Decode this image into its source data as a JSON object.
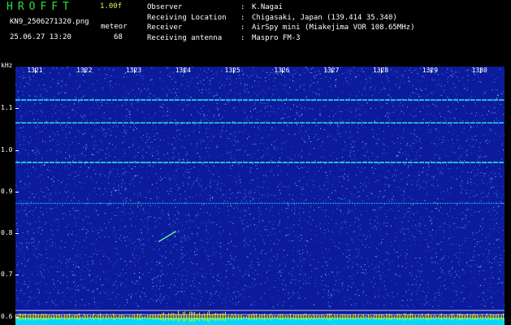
{
  "header": {
    "app_title": "HROFFT",
    "version": "1.00f",
    "filename": "KN9_2506271320.png",
    "datetime": "25.06.27 13:20",
    "meteor_label": "meteor",
    "meteor_count": "68"
  },
  "info": [
    {
      "key": "Observer",
      "sep": ":",
      "value": "K.Nagai"
    },
    {
      "key": "Receiving Location",
      "sep": ":",
      "value": "Chigasaki, Japan (139.414 35.340)"
    },
    {
      "key": "Receiver",
      "sep": ":",
      "value": "AirSpy mini (Miakejima VOR 108.65MHz)"
    },
    {
      "key": "Receiving antenna",
      "sep": ":",
      "value": "Maspro FM-3"
    }
  ],
  "chart_data": {
    "type": "heatmap",
    "ylabel": "kHz",
    "x_ticks": [
      "1321",
      "1322",
      "1323",
      "1324",
      "1325",
      "1326",
      "1327",
      "1328",
      "1329",
      "1330"
    ],
    "y_ticks": [
      "1.1",
      "1.0",
      "0.9",
      "0.8",
      "0.7",
      "0.6"
    ],
    "ylim": [
      0.58,
      1.2
    ],
    "xlim": [
      1320.6,
      1330.5
    ],
    "horizontal_lines_khz": [
      1.12,
      1.065,
      0.97,
      0.872
    ],
    "reference_lines_khz": [
      0.615,
      0.605
    ],
    "meteor_echo": {
      "x_start": 1323.5,
      "x_end": 1323.85,
      "y_start": 0.78,
      "y_end": 0.805
    },
    "colors": {
      "background": "#0c1b9c",
      "noise": "#5aa0ff",
      "signal": "#2fe8e0",
      "bottom_bar": "#00d8ff",
      "bottom_spikes": "#e8e800"
    }
  }
}
